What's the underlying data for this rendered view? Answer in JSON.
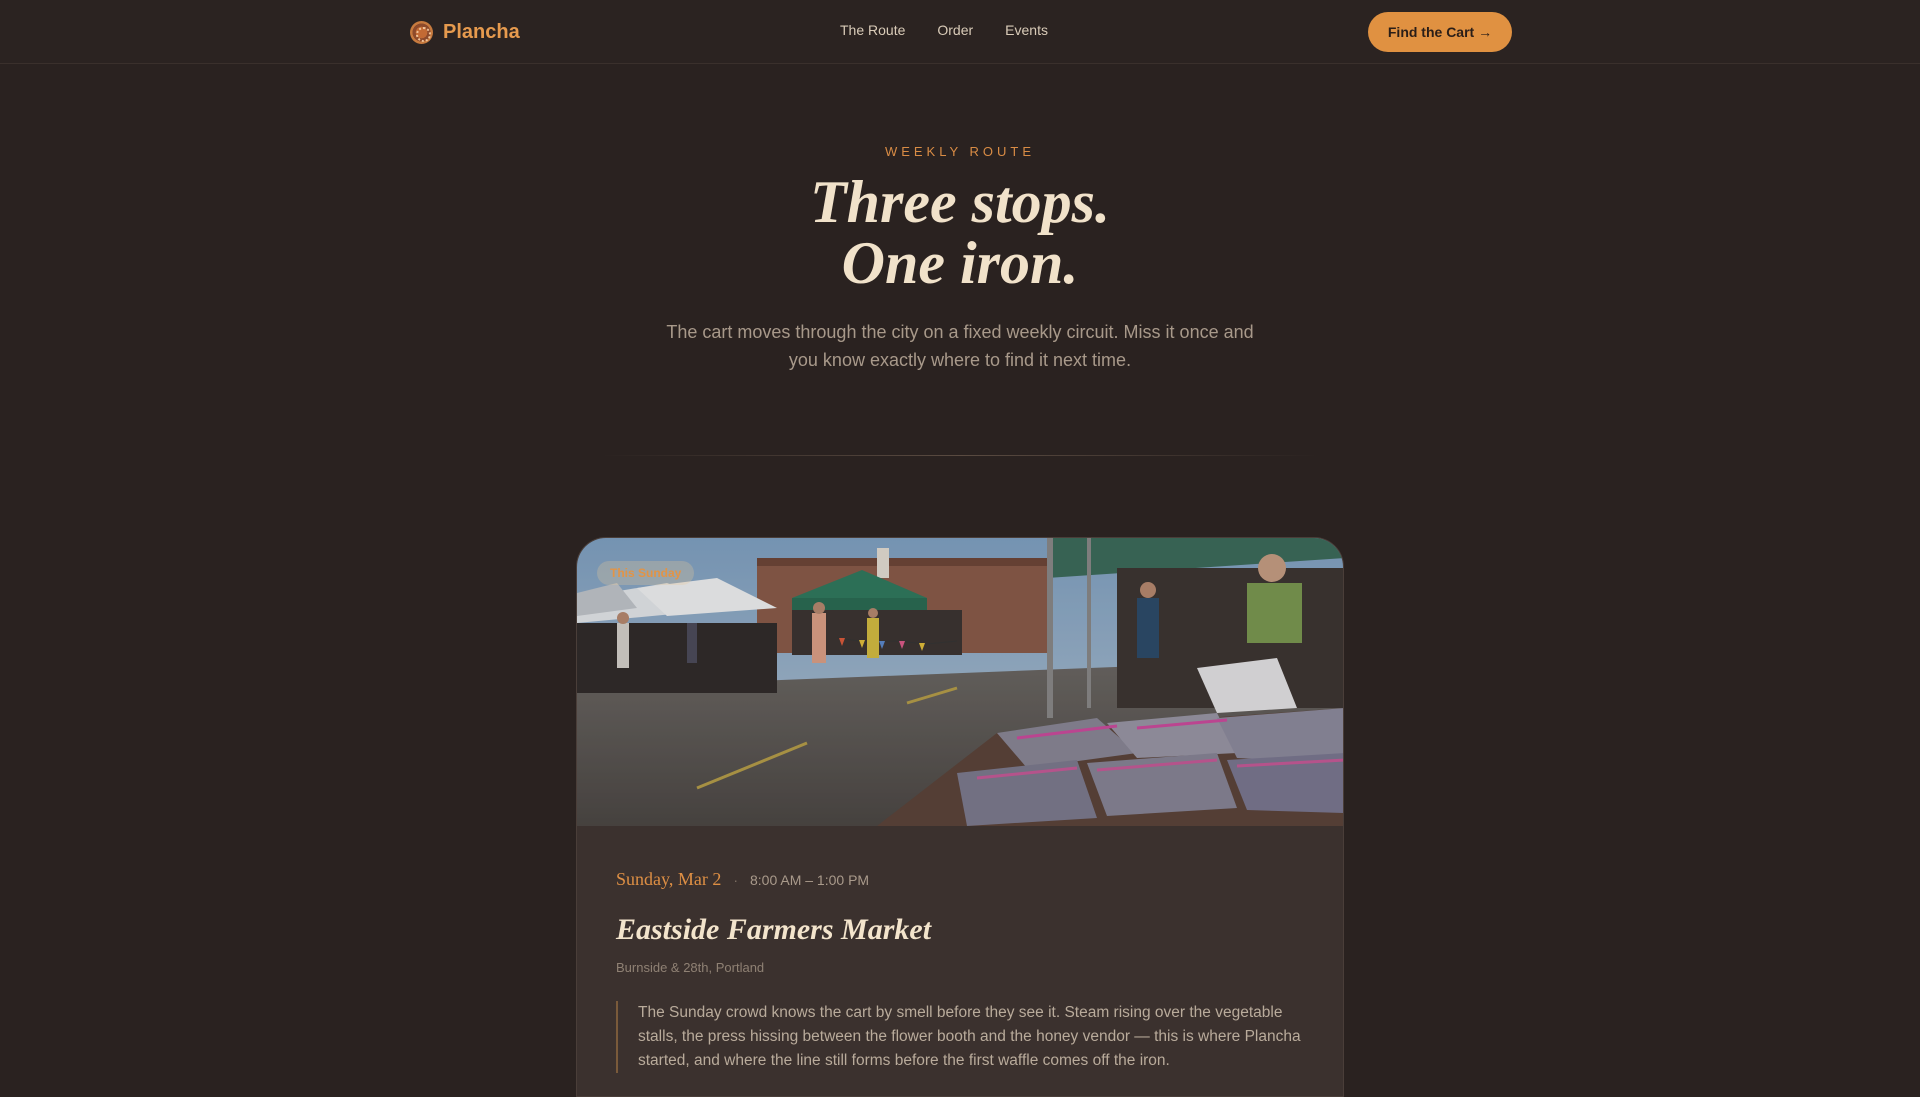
{
  "brand": {
    "name": "Plancha",
    "logo_icon": "plancha-logo-icon"
  },
  "nav": {
    "links": [
      {
        "label": "The Route"
      },
      {
        "label": "Order"
      },
      {
        "label": "Events"
      }
    ],
    "cta_label": "Find the Cart →"
  },
  "hero": {
    "eyebrow": "WEEKLY ROUTE",
    "title_line1": "Three stops.",
    "title_line2": "One iron.",
    "subtitle": "The cart moves through the city on a fixed weekly circuit. Miss it once and you know exactly where to find it next time."
  },
  "stop": {
    "badge": "This Sunday",
    "date": "Sunday, Mar 2",
    "separator": "·",
    "hours": "8:00 AM – 1:00 PM",
    "venue": "Eastside Farmers Market",
    "address": "Burnside & 28th, Portland",
    "description": "The Sunday crowd knows the cart by smell before they see it. Steam rising over the vegetable stalls, the press hissing between the flower booth and the honey vendor — this is where Plancha started, and where the line still forms before the first waffle comes off the iron.",
    "photo_icon": "farmers-market-photo"
  },
  "colors": {
    "background": "#2a2220",
    "accent": "#e09141",
    "heading": "#f1e2ca",
    "muted": "#a8998a"
  }
}
